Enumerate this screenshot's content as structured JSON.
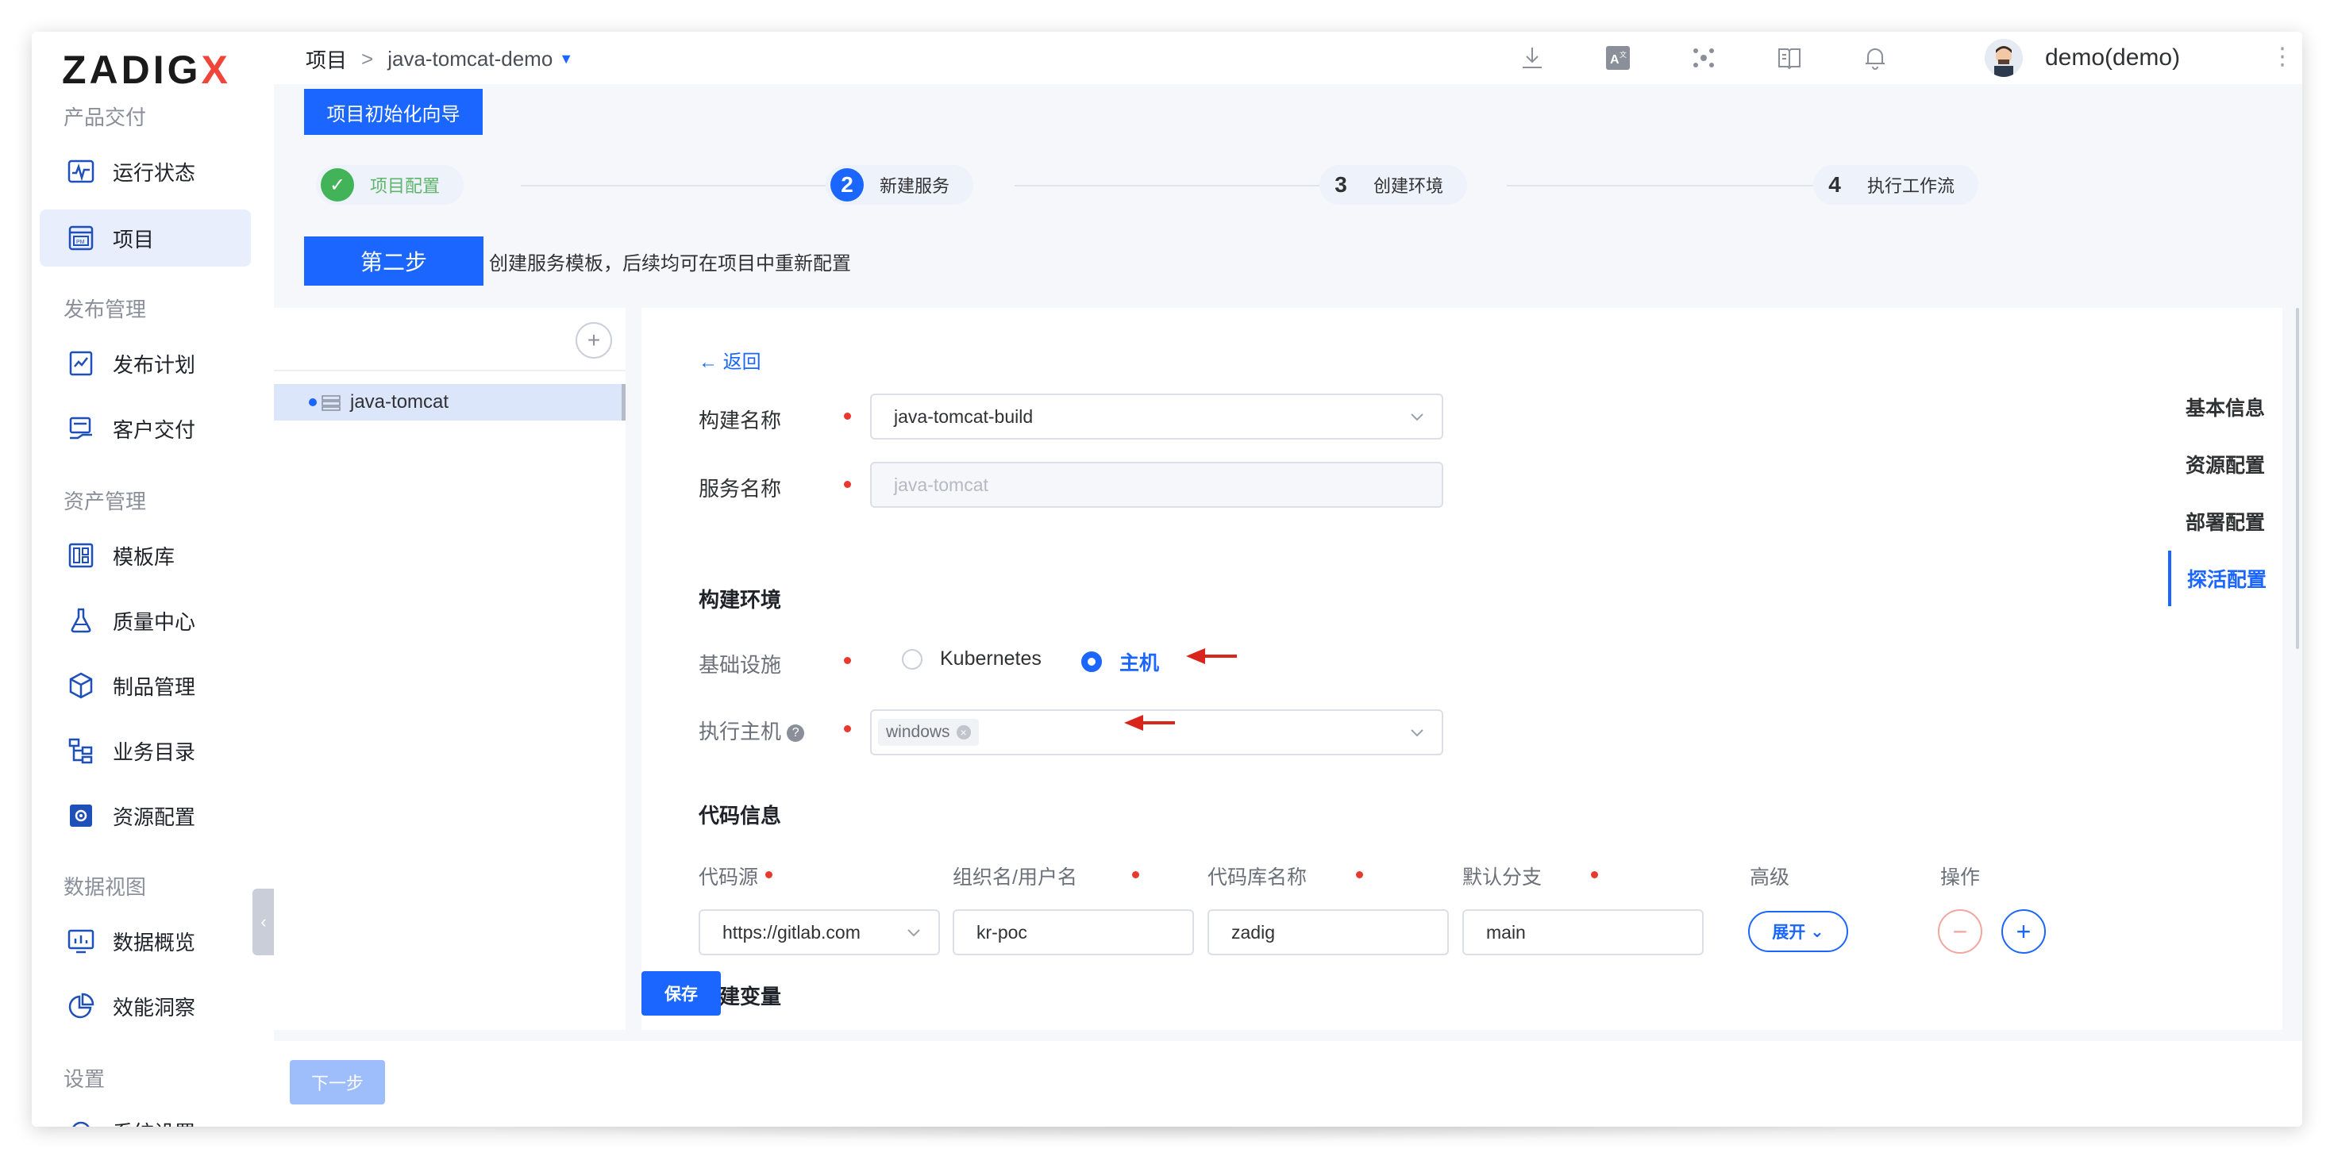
{
  "app": {
    "logo_main": "ZADIG",
    "logo_accent": "X",
    "brand_color": "#1a66ff"
  },
  "sidebar": {
    "sections": [
      {
        "title": "产品交付",
        "items": [
          {
            "label": "运行状态",
            "icon": "pulse-monitor-icon",
            "active": false
          },
          {
            "label": "项目",
            "icon": "project-pm-icon",
            "active": true
          }
        ]
      },
      {
        "title": "发布管理",
        "items": [
          {
            "label": "发布计划",
            "icon": "release-plan-icon",
            "active": false
          },
          {
            "label": "客户交付",
            "icon": "customer-delivery-icon",
            "active": false
          }
        ]
      },
      {
        "title": "资产管理",
        "items": [
          {
            "label": "模板库",
            "icon": "template-library-icon",
            "active": false
          },
          {
            "label": "质量中心",
            "icon": "flask-icon",
            "active": false
          },
          {
            "label": "制品管理",
            "icon": "artifact-box-icon",
            "active": false
          },
          {
            "label": "业务目录",
            "icon": "catalog-tree-icon",
            "active": false
          },
          {
            "label": "资源配置",
            "icon": "resource-gear-icon",
            "active": false
          }
        ]
      },
      {
        "title": "数据视图",
        "items": [
          {
            "label": "数据概览",
            "icon": "dashboard-chart-icon",
            "active": false
          },
          {
            "label": "效能洞察",
            "icon": "pie-chart-icon",
            "active": false
          }
        ]
      },
      {
        "title": "设置",
        "items": [
          {
            "label": "系统设置",
            "icon": "settings-gear-icon",
            "active": false
          }
        ]
      }
    ]
  },
  "topbar": {
    "breadcrumb_root": "项目",
    "breadcrumb_sep": ">",
    "breadcrumb_project": "java-tomcat-demo",
    "icons": [
      "download-icon",
      "translate-icon",
      "cluster-icon",
      "docs-book-icon",
      "bell-icon"
    ],
    "username": "demo(demo)"
  },
  "wizard": {
    "guide_button": "项目初始化向导",
    "steps": [
      {
        "num": "✓",
        "label": "项目配置",
        "state": "done"
      },
      {
        "num": "2",
        "label": "新建服务",
        "state": "active"
      },
      {
        "num": "3",
        "label": "创建环境",
        "state": "todo"
      },
      {
        "num": "4",
        "label": "执行工作流",
        "state": "todo"
      }
    ],
    "step_tag": "第二步",
    "step_desc": "创建服务模板，后续均可在项目中重新配置"
  },
  "services": {
    "add_label": "+",
    "items": [
      {
        "name": "java-tomcat",
        "selected": true
      }
    ]
  },
  "form": {
    "back_label": "返回",
    "build_name_label": "构建名称",
    "build_name_value": "java-tomcat-build",
    "service_name_label": "服务名称",
    "service_name_value": "java-tomcat",
    "env_section": "构建环境",
    "infra_label": "基础设施",
    "infra_options": [
      "Kubernetes",
      "主机"
    ],
    "infra_selected": "主机",
    "exec_host_label": "执行主机",
    "exec_host_tags": [
      "windows"
    ],
    "code_section": "代码信息",
    "code_columns": [
      "代码源",
      "组织名/用户名",
      "代码库名称",
      "默认分支",
      "高级",
      "操作"
    ],
    "code_row": {
      "source": "https://gitlab.com",
      "org": "kr-poc",
      "repo": "zadig",
      "branch": "main",
      "expand_label": "展开"
    },
    "vars_section_partial": "建变量",
    "save_label": "保存"
  },
  "anchor_nav": {
    "items": [
      "基本信息",
      "资源配置",
      "部署配置",
      "探活配置"
    ],
    "active": "探活配置"
  },
  "footer": {
    "next_label": "下一步"
  }
}
